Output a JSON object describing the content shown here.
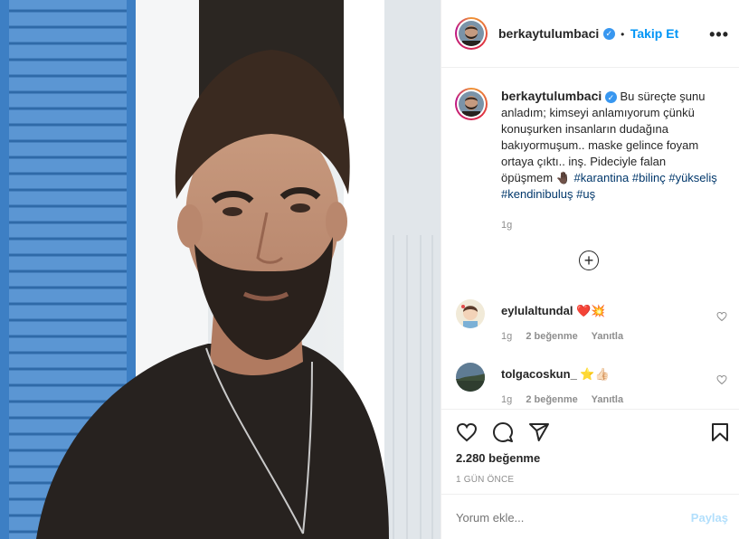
{
  "post": {
    "username": "berkaytulumbaci",
    "follow_label": "Takip Et",
    "dot": "•",
    "more": "•••",
    "caption_text": "Bu süreçte şunu anladım; kimseyi anlamıyorum çünkü konuşurken insanların dudağına bakıyormuşum.. maske gelince foyam ortaya çıktı.. inş. Pideciyle falan öpüşmem",
    "caption_emoji": "🤚🏿",
    "hashtags": [
      "#karantina",
      "#bilinç",
      "#yükseliş",
      "#kendinibuluş",
      "#uş"
    ],
    "caption_time": "1g"
  },
  "comments": [
    {
      "username": "eylulaltundal",
      "text": "❤️💥",
      "time": "1g",
      "likes": "2 beğenme",
      "reply": "Yanıtla"
    },
    {
      "username": "tolgacoskun_",
      "text": "⭐👍🏻",
      "time": "1g",
      "likes": "2 beğenme",
      "reply": "Yanıtla"
    }
  ],
  "actions": {
    "likes_count": "2.280 beğenme",
    "date": "1 GÜN ÖNCE"
  },
  "add_comment": {
    "placeholder": "Yorum ekle...",
    "post_label": "Paylaş"
  },
  "colors": {
    "link": "#0095f6",
    "hashtag": "#00376b",
    "shutter_blue": "#4a88c7"
  }
}
